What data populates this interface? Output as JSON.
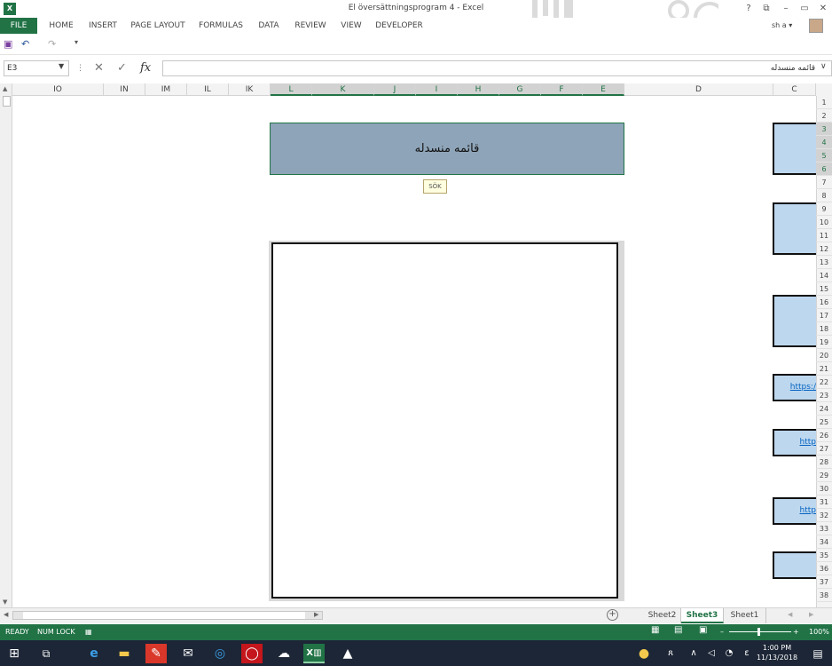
{
  "window": {
    "title": "El översättningsprogram 4 - Excel",
    "app_badge": "X",
    "controls": [
      "?",
      "⧉",
      "–",
      "▭",
      "✕"
    ]
  },
  "ribbon": {
    "tabs": [
      "FILE",
      "HOME",
      "INSERT",
      "PAGE LAYOUT",
      "FORMULAS",
      "DATA",
      "REVIEW",
      "VIEW",
      "DEVELOPER"
    ],
    "user": "sh a ▾"
  },
  "formula_bar": {
    "name_box": "E3",
    "content": "قائمه منسدله"
  },
  "columns": [
    "IO",
    "IN",
    "IM",
    "IL",
    "IK",
    "L",
    "K",
    "J",
    "I",
    "H",
    "G",
    "F",
    "E",
    "D",
    "C"
  ],
  "rows": [
    "1",
    "2",
    "3",
    "4",
    "5",
    "6",
    "7",
    "8",
    "9",
    "10",
    "11",
    "12",
    "13",
    "14",
    "15",
    "16",
    "17",
    "18",
    "19",
    "20",
    "21",
    "22",
    "23",
    "24",
    "25",
    "26",
    "27",
    "28",
    "29",
    "30",
    "31",
    "32",
    "33",
    "34",
    "35",
    "36",
    "37",
    "38"
  ],
  "sheet": {
    "header_text": "قائمه منسدله",
    "search_button": "SÖK",
    "links": [
      "https:/",
      "http",
      "http"
    ]
  },
  "sheet_tabs": [
    "Sheet2",
    "Sheet3",
    "Sheet1"
  ],
  "active_sheet": "Sheet3",
  "status": {
    "ready": "READY",
    "num_lock": "NUM LOCK",
    "zoom": "100%"
  },
  "taskbar": {
    "time": "1:00 PM",
    "date": "11/13/2018"
  },
  "colors": {
    "excel_green": "#217346",
    "header_fill": "#8ea4b8",
    "box_fill": "#bdd7ee",
    "link": "#0563c1"
  }
}
